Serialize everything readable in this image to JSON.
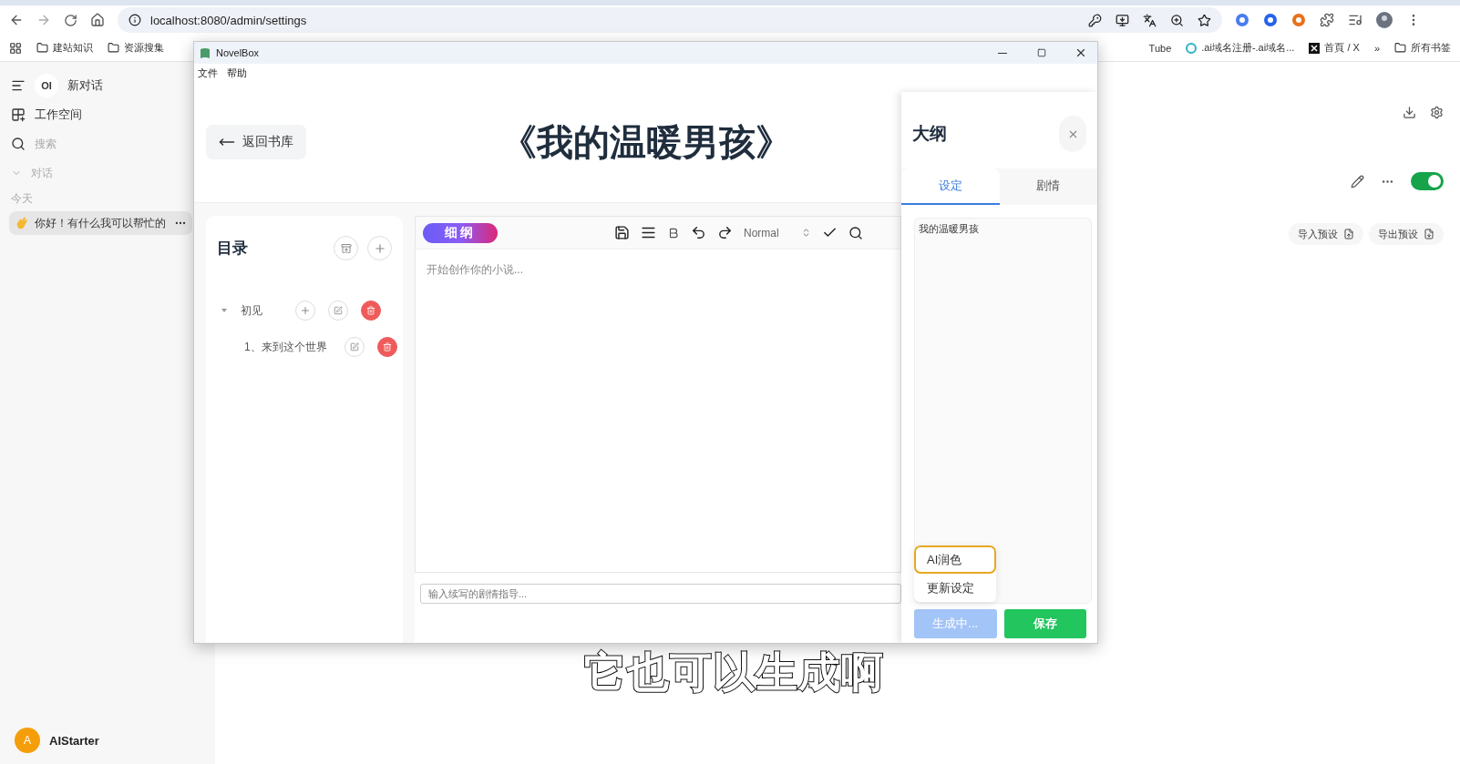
{
  "browser": {
    "url": "localhost:8080/admin/settings",
    "bookmarks": [
      {
        "label": "建站知识",
        "kind": "folder"
      },
      {
        "label": "资源搜集",
        "kind": "folder"
      }
    ],
    "bookmarks_right": [
      {
        "label": "Tube",
        "kind": "site"
      },
      {
        "label": ".ai域名注册-.ai域名...",
        "kind": "site"
      },
      {
        "label": "首頁 / X",
        "kind": "x"
      }
    ],
    "more": "»",
    "all_bookmarks": "所有书签"
  },
  "webapp": {
    "sidebar": {
      "logo": "OI",
      "new_chat": "新对话",
      "workspace": "工作空间",
      "search_placeholder": "搜索",
      "section": {
        "label": "对话",
        "expanded": true
      },
      "day": "今天",
      "chats": [
        {
          "title": "你好！有什么我可以帮忙的",
          "selected": true
        }
      ],
      "user": {
        "initial": "A",
        "name": "AIStarter"
      }
    },
    "toggle": {
      "on": true
    },
    "buttons": [
      {
        "label": "导入预设",
        "kind": "import"
      },
      {
        "label": "导出预设",
        "kind": "export"
      }
    ]
  },
  "app": {
    "window": {
      "title": "NovelBox"
    },
    "menu": [
      "文件",
      "帮助"
    ],
    "back": "返回书库",
    "book_title": "《我的温暖男孩》",
    "toc": {
      "title": "目录",
      "chapters": [
        {
          "title": "初见",
          "expanded": true,
          "children": [
            {
              "title": "1、来到这个世界"
            }
          ]
        }
      ]
    },
    "editor": {
      "badge": "细纲",
      "style_select": "Normal",
      "placeholder": "开始创作你的小说...",
      "guide_placeholder": "输入续写的剧情指导..."
    },
    "outline": {
      "title": "大纲",
      "tabs": [
        {
          "label": "设定",
          "selected": true
        },
        {
          "label": "剧情",
          "selected": false
        }
      ],
      "text": "我的温暖男孩",
      "menu": [
        {
          "label": "AI润色",
          "selected": true
        },
        {
          "label": "更新设定",
          "selected": false
        }
      ],
      "generate": {
        "label": "生成中...",
        "disabled": true
      },
      "save": "保存"
    }
  },
  "subtitle": "它也可以生成啊"
}
